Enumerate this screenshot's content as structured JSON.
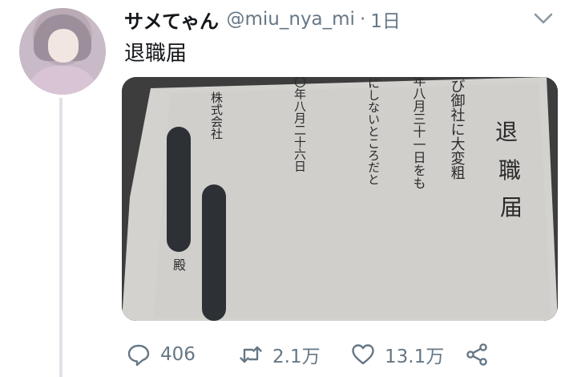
{
  "author": {
    "display_name": "サメてゃん",
    "handle": "@miu_nya_mi",
    "separator": "·",
    "time": "1日"
  },
  "tweet": {
    "text": "退職届"
  },
  "letter": {
    "title_col1": "退",
    "title_col2": "職",
    "title_col3": "届",
    "body_col1": "このたび御社に大変粗",
    "body_col2": "二〇二〇年八月三十一日をも",
    "body_col3": "新卒を大事にしないところだと",
    "date_col": "二〇二〇年八月二十六日",
    "company_col": "株式会社",
    "honorific": "殿"
  },
  "actions": {
    "reply_count": "406",
    "retweet_count": "2.1万",
    "like_count": "13.1万"
  },
  "icons": [
    "reply-icon",
    "retweet-icon",
    "like-icon",
    "share-icon",
    "chevron-down-icon"
  ],
  "colors": {
    "text": "#14171a",
    "muted": "#657786",
    "thread_line": "#dfe3e6"
  }
}
